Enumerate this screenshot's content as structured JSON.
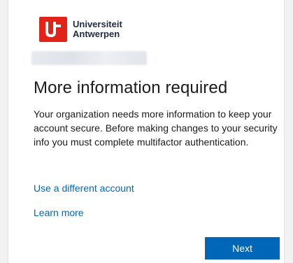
{
  "brand": {
    "name_line1": "Universiteit",
    "name_line2": "Antwerpen",
    "logo_icon": "uantwerpen-logo-icon",
    "logo_color": "#e2231a"
  },
  "account": {
    "display": "",
    "obscured": true
  },
  "main": {
    "title": "More information required",
    "description": "Your organization needs more information to keep your account secure. Before making changes to your security info you must complete multifactor authentication."
  },
  "links": {
    "different_account": "Use a different account",
    "learn_more": "Learn more"
  },
  "actions": {
    "next_label": "Next",
    "accent_color": "#0067b8"
  }
}
